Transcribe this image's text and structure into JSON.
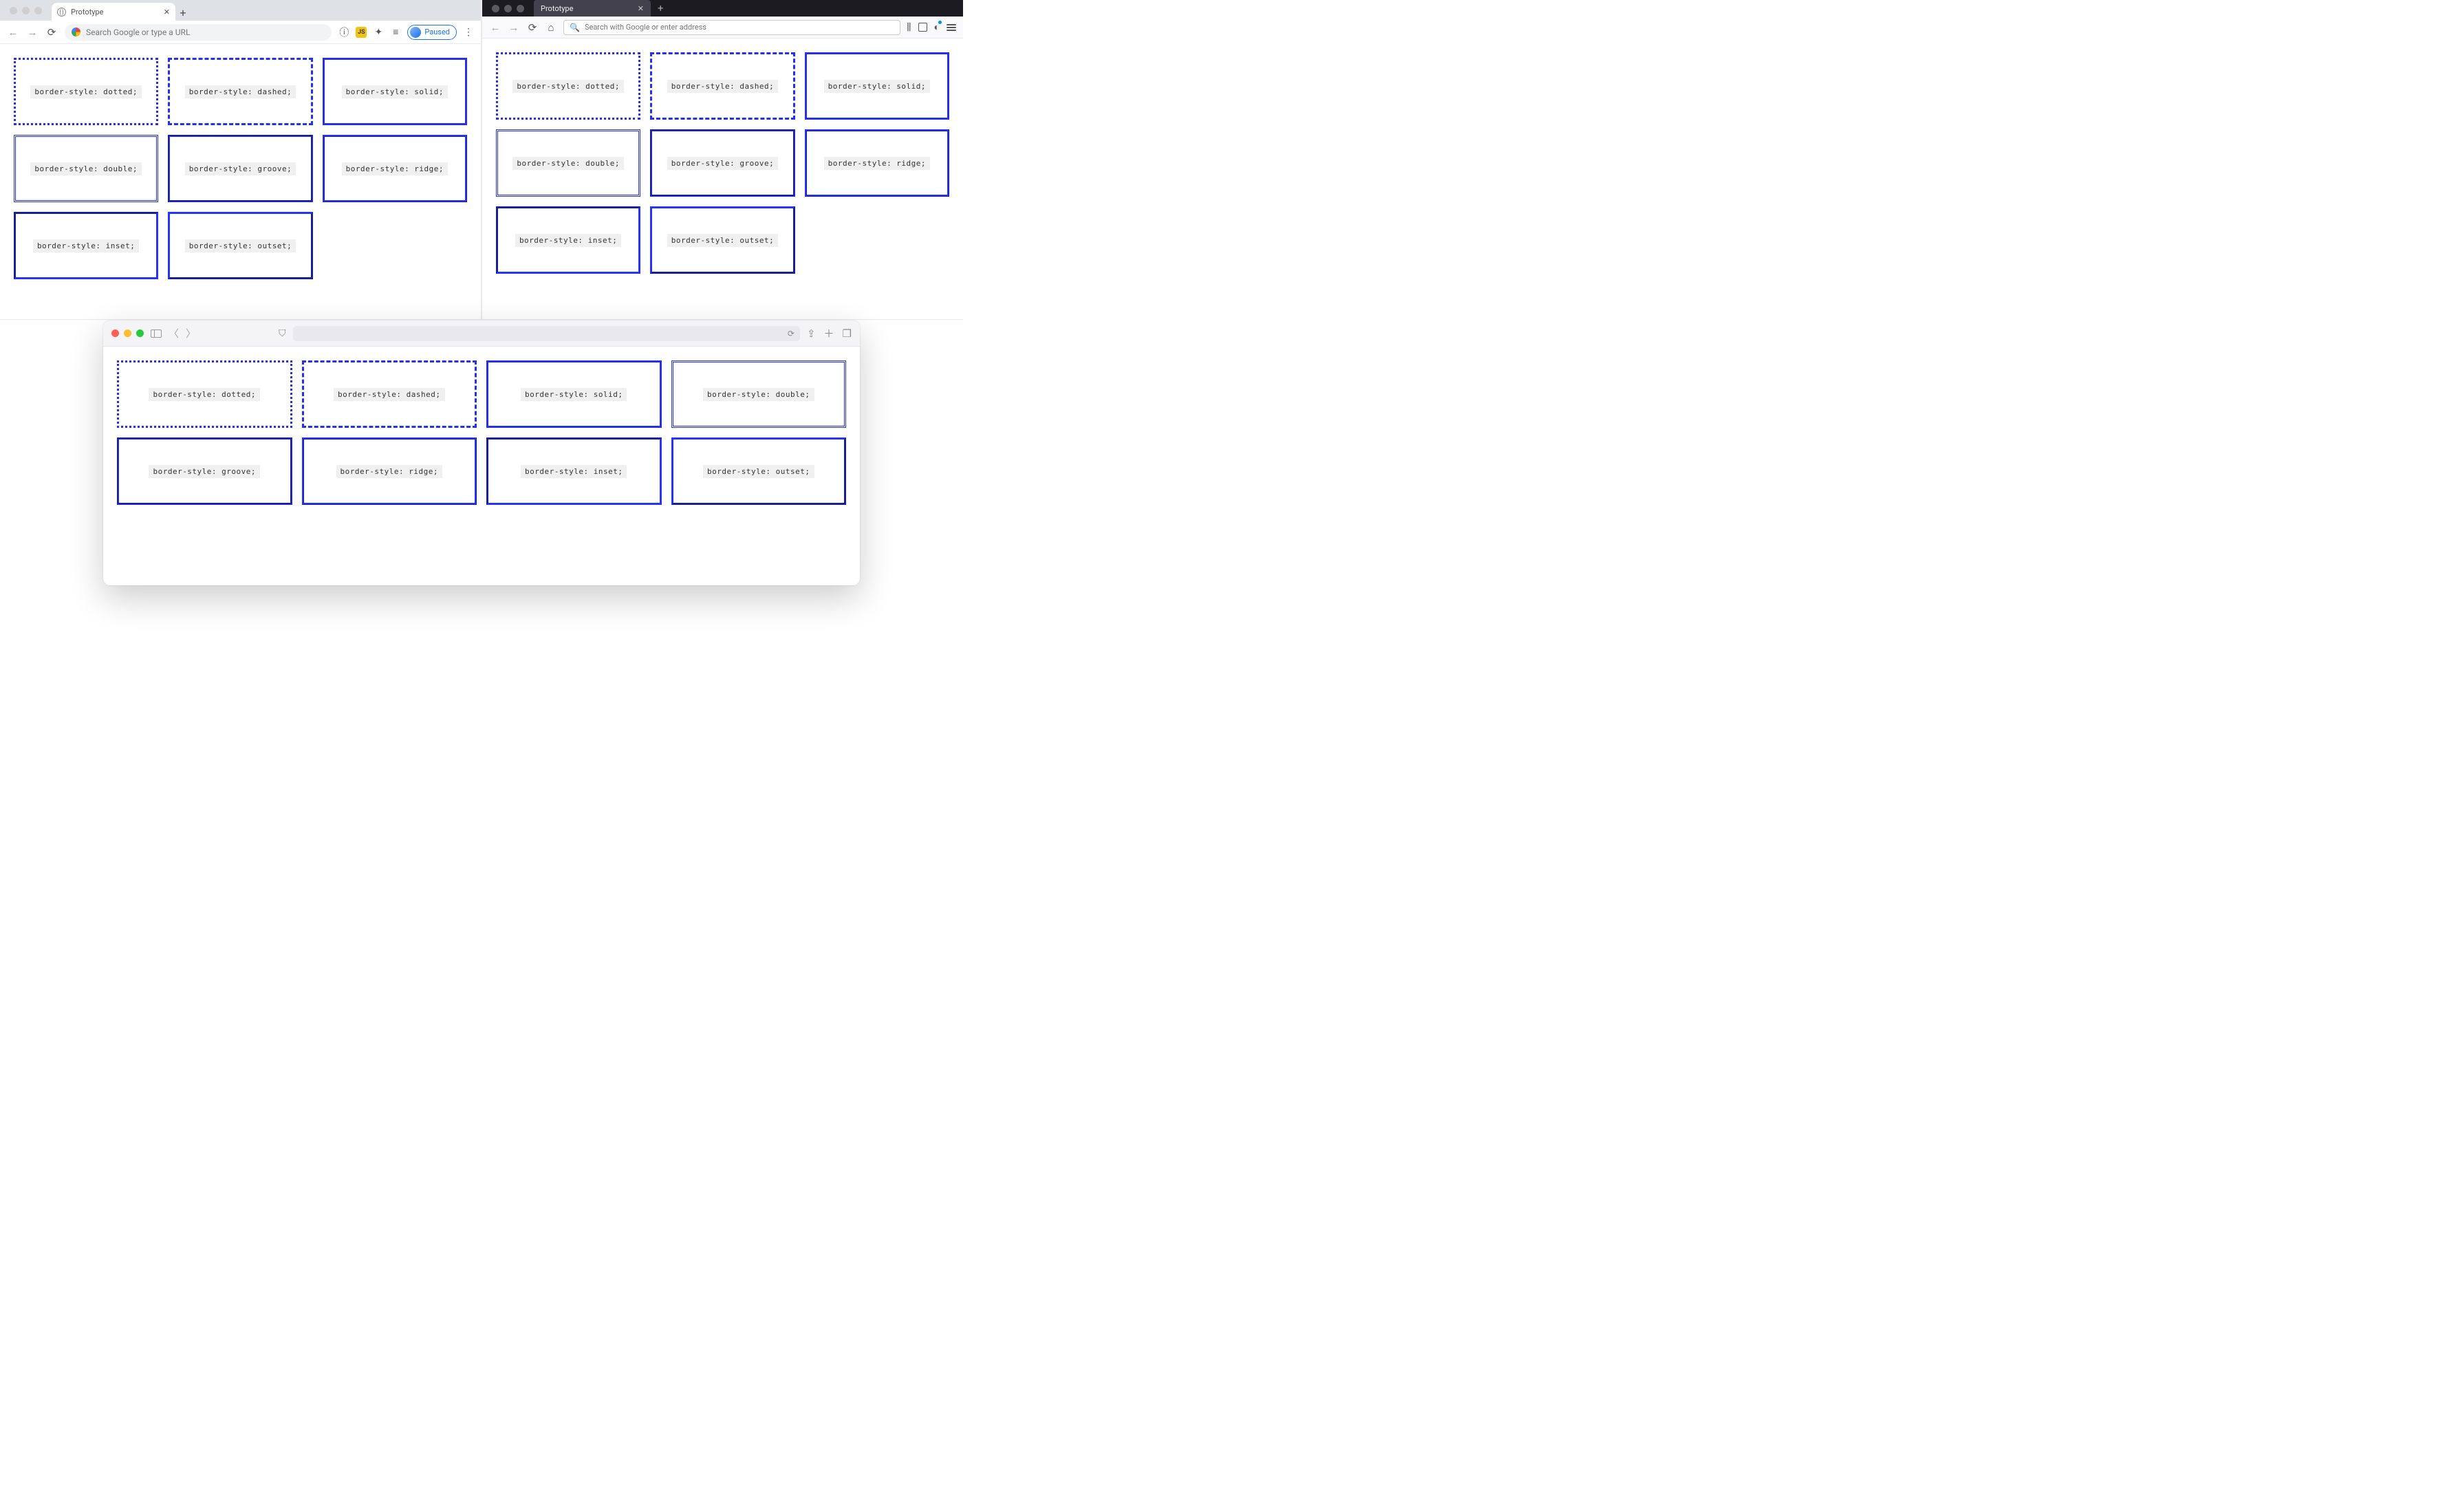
{
  "chrome": {
    "tab_title": "Prototype",
    "omnibox_placeholder": "Search Google or type a URL",
    "profile_label": "Paused"
  },
  "firefox": {
    "tab_title": "Prototype",
    "urlbar_placeholder": "Search with Google or enter address"
  },
  "safari": {
    "urlbar_placeholder": ""
  },
  "content": {
    "border_color": "#2430ee",
    "cards": [
      {
        "style": "dotted",
        "label": "border-style: dotted;"
      },
      {
        "style": "dashed",
        "label": "border-style: dashed;"
      },
      {
        "style": "solid",
        "label": "border-style: solid;"
      },
      {
        "style": "double",
        "label": "border-style: double;"
      },
      {
        "style": "groove",
        "label": "border-style: groove;"
      },
      {
        "style": "ridge",
        "label": "border-style: ridge;"
      },
      {
        "style": "inset",
        "label": "border-style: inset;"
      },
      {
        "style": "outset",
        "label": "border-style: outset;"
      }
    ]
  }
}
